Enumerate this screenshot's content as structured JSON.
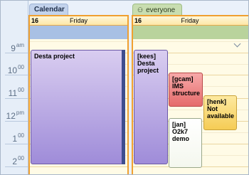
{
  "time_labels": [
    {
      "hour": "9",
      "suffix": "am"
    },
    {
      "hour": "10",
      "suffix": "00"
    },
    {
      "hour": "11",
      "suffix": "00"
    },
    {
      "hour": "12",
      "suffix": "pm"
    },
    {
      "hour": "1",
      "suffix": "00"
    },
    {
      "hour": "2",
      "suffix": "00"
    }
  ],
  "calendars": [
    {
      "tab": "Calendar",
      "day_number": "16",
      "day_name": "Friday",
      "tab_color": "#c3d3ec",
      "allday_color": "#a8c0e4",
      "appointments": [
        {
          "text": "Desta project",
          "color_top": "#d9cdf0",
          "color_bottom": "#9f8cd9"
        }
      ]
    },
    {
      "tab": "everyone",
      "day_number": "16",
      "day_name": "Friday",
      "tab_color": "#c8ddb0",
      "allday_color": "#b9d39c",
      "appointments": [
        {
          "text": "[kees] Desta project",
          "color_top": "#d9cdf0",
          "color_bottom": "#9f8cd9"
        },
        {
          "text": "[gcam] IMS structure",
          "color_top": "#f7a9a9",
          "color_bottom": "#e56b6b"
        },
        {
          "text": "[henk] Not available",
          "color_top": "#fde9a0",
          "color_bottom": "#f5cc55"
        },
        {
          "text": "[jan] O2k7 demo",
          "color_top": "#ffffff",
          "color_bottom": "#f4f7ee"
        }
      ]
    }
  ]
}
